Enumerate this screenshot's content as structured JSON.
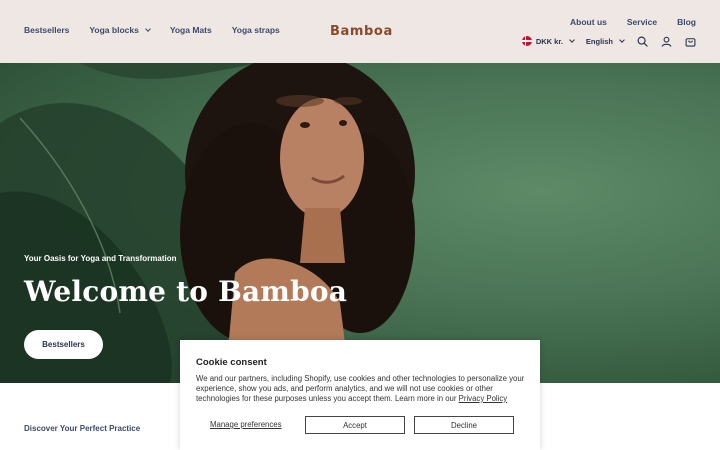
{
  "header": {
    "nav_left": [
      {
        "label": "Bestsellers"
      },
      {
        "label": "Yoga blocks"
      },
      {
        "label": "Yoga Mats"
      },
      {
        "label": "Yoga straps"
      }
    ],
    "logo": "Bamboa",
    "nav_right_top": [
      {
        "label": "About us"
      },
      {
        "label": "Service"
      },
      {
        "label": "Blog"
      }
    ],
    "currency": "DKK kr.",
    "language": "English",
    "icons": [
      "search-icon",
      "account-icon",
      "cart-icon"
    ]
  },
  "hero": {
    "subtitle": "Your Oasis for Yoga and Transformation",
    "title": "Welcome to Bamboa",
    "button_label": "Bestsellers"
  },
  "section": {
    "heading": "Discover Your Perfect Practice"
  },
  "cookie": {
    "title": "Cookie consent",
    "text": "We and our partners, including Shopify, use cookies and other technologies to personalize your experience, show you ads, and perform analytics, and we will not use cookies or other technologies for these purposes unless you accept them. Learn more in our",
    "privacy_link": "Privacy Policy",
    "manage_label": "Manage preferences",
    "accept_label": "Accept",
    "decline_label": "Decline"
  },
  "colors": {
    "header_bg": "#efe7e4",
    "hero_green": "#4a7455",
    "nav_text": "#3c4a6b",
    "logo": "#8a4a2a"
  }
}
